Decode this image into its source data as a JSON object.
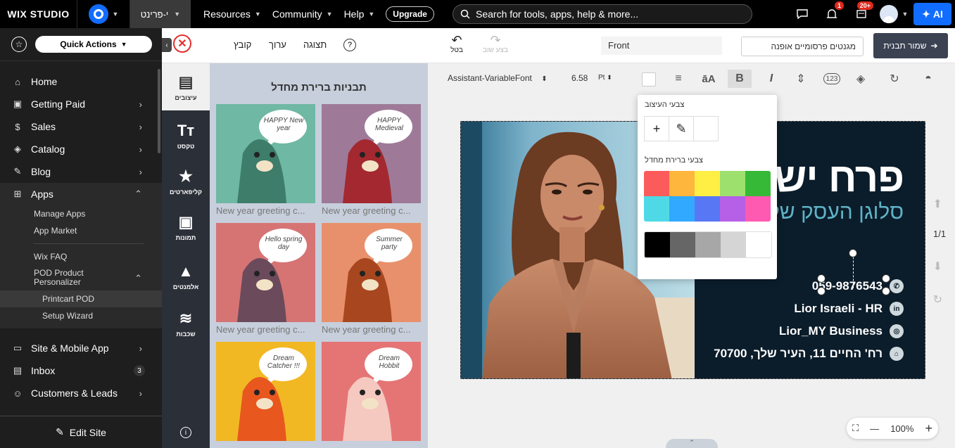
{
  "topbar": {
    "logo": "WIX STUDIO",
    "site_name": "י-פרינט",
    "nav": [
      {
        "label": "Resources"
      },
      {
        "label": "Community"
      },
      {
        "label": "Help"
      }
    ],
    "upgrade": "Upgrade",
    "search_placeholder": "Search for tools, apps, help & more...",
    "notif_badge": "1",
    "updates_badge": "20+",
    "ai_label": "AI"
  },
  "sidebar": {
    "quick_actions": "Quick Actions",
    "items": [
      {
        "label": "Home",
        "icon": "home-icon",
        "arrow": ""
      },
      {
        "label": "Getting Paid",
        "icon": "wallet-icon",
        "arrow": "›"
      },
      {
        "label": "Sales",
        "icon": "dollar-icon",
        "arrow": "›"
      },
      {
        "label": "Catalog",
        "icon": "catalog-icon",
        "arrow": "›"
      },
      {
        "label": "Blog",
        "icon": "pen-icon",
        "arrow": "›"
      }
    ],
    "apps": {
      "label": "Apps",
      "arrow": "⌃"
    },
    "apps_sub": [
      "Manage Apps",
      "App Market"
    ],
    "apps_sub2": [
      "Wix FAQ"
    ],
    "pod": {
      "label": "POD Product Personalizer",
      "arrow": "⌃"
    },
    "pod_sub": [
      "Printcart POD",
      "Setup Wizard"
    ],
    "bottom_items": [
      {
        "label": "Site & Mobile App",
        "arrow": "›"
      },
      {
        "label": "Inbox",
        "badge": "3"
      },
      {
        "label": "Customers & Leads",
        "arrow": "›"
      }
    ],
    "edit_site": "Edit Site"
  },
  "toolbar": {
    "file": "קובץ",
    "edit": "ערוך",
    "view": "תצוגה",
    "help": "?",
    "undo": "בטל",
    "redo": "בצע שוב",
    "side": "Front",
    "product": "מגנטים פרסומיים אופנה",
    "save": "שמור תבנית"
  },
  "iconcol": {
    "items": [
      {
        "label": "עיצובים",
        "icon": "designs-icon"
      },
      {
        "label": "טקסט",
        "icon": "text-icon"
      },
      {
        "label": "קליפארטים",
        "icon": "star-icon"
      },
      {
        "label": "תמונות",
        "icon": "image-icon"
      },
      {
        "label": "אלמנטים",
        "icon": "shapes-icon"
      },
      {
        "label": "שכבות",
        "icon": "layers-icon"
      }
    ]
  },
  "templates": {
    "title": "תבניות ברירת מחדל",
    "items": [
      {
        "caption": "New year greeting c...",
        "bubble": "HAPPY New year",
        "bg": "#6fb8a3",
        "animal": "#3d7d6a"
      },
      {
        "caption": "New year greeting c...",
        "bubble": "HAPPY Medieval",
        "bg": "#9e7a98",
        "animal": "#a3282f"
      },
      {
        "caption": "New year greeting c...",
        "bubble": "Hello spring day",
        "bg": "#d67474",
        "animal": "#6b4a5c"
      },
      {
        "caption": "New year greeting c...",
        "bubble": "Summer party",
        "bg": "#e8906c",
        "animal": "#a8471f"
      },
      {
        "caption": "",
        "bubble": "Dream Catcher !!!",
        "bg": "#f2b824",
        "animal": "#e8571e"
      },
      {
        "caption": "",
        "bubble": "Dream Hobbit",
        "bg": "#e57474",
        "animal": "#f5c8c0"
      }
    ]
  },
  "format": {
    "font": "Assistant-VariableFont",
    "size": "6.58",
    "unit": "Pt",
    "case_label": "āA",
    "bold": "B",
    "italic": "I",
    "numbers": "123"
  },
  "colorpicker": {
    "design_colors_label": "צבעי העיצוב",
    "default_colors_label": "צבעי ברירת מחדל",
    "add": "+",
    "colors_row1": [
      "#fb5b5b",
      "#ffb63c",
      "#ffef45",
      "#9ee06d",
      "#36b936"
    ],
    "colors_row2": [
      "#4fd9e6",
      "#31a9ff",
      "#5877f5",
      "#b560e6",
      "#ff5ab1"
    ],
    "greys": [
      "#000000",
      "#666666",
      "#a7a7a7",
      "#d5d5d5",
      "#ffffff"
    ]
  },
  "card": {
    "title": "פרח ישר",
    "slogan": "סלוגן העסק של",
    "phone": "059-9876543",
    "linkedin": "Lior Israeli - HR",
    "instagram": "Lior_MY Business",
    "address": "רח' החיים 11, העיר שלך, 70700",
    "bg": "#0b1c2a"
  },
  "canvas": {
    "page_indicator": "1/1",
    "zoom": "100%",
    "zoom_minus": "—",
    "zoom_plus": "+"
  }
}
